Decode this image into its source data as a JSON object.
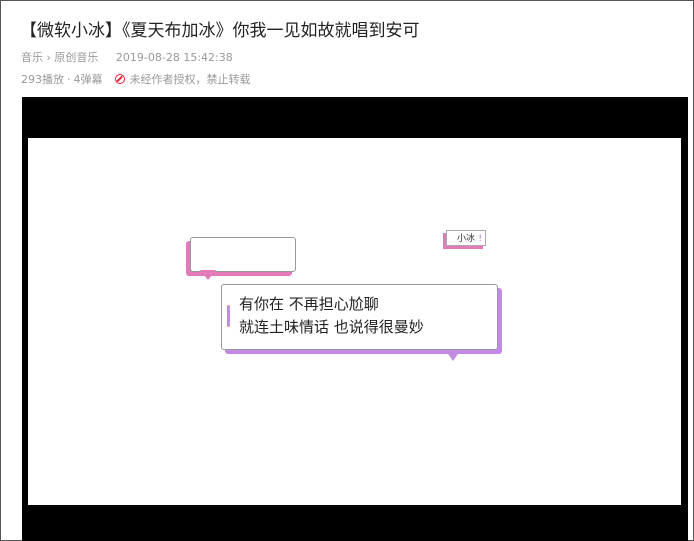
{
  "title": "【微软小冰】《夏天布加冰》你我一见如故就唱到安可",
  "breadcrumb": {
    "category": "音乐",
    "separator": "›",
    "subcategory": "原创音乐"
  },
  "publish_time": "2019-08-28 15:42:38",
  "stats": {
    "plays": "293播放",
    "separator": "·",
    "danmaku": "4弹幕"
  },
  "copyright_notice": "未经作者授权，禁止转载",
  "video": {
    "tag_label": "小冰",
    "tag_mark": "!",
    "lyrics": [
      "有你在 不再担心尬聊",
      "就连土味情话 也说得很曼妙"
    ]
  },
  "colors": {
    "pink": "#e57ab8",
    "purple": "#c48be6",
    "warning": "#ee2233"
  }
}
